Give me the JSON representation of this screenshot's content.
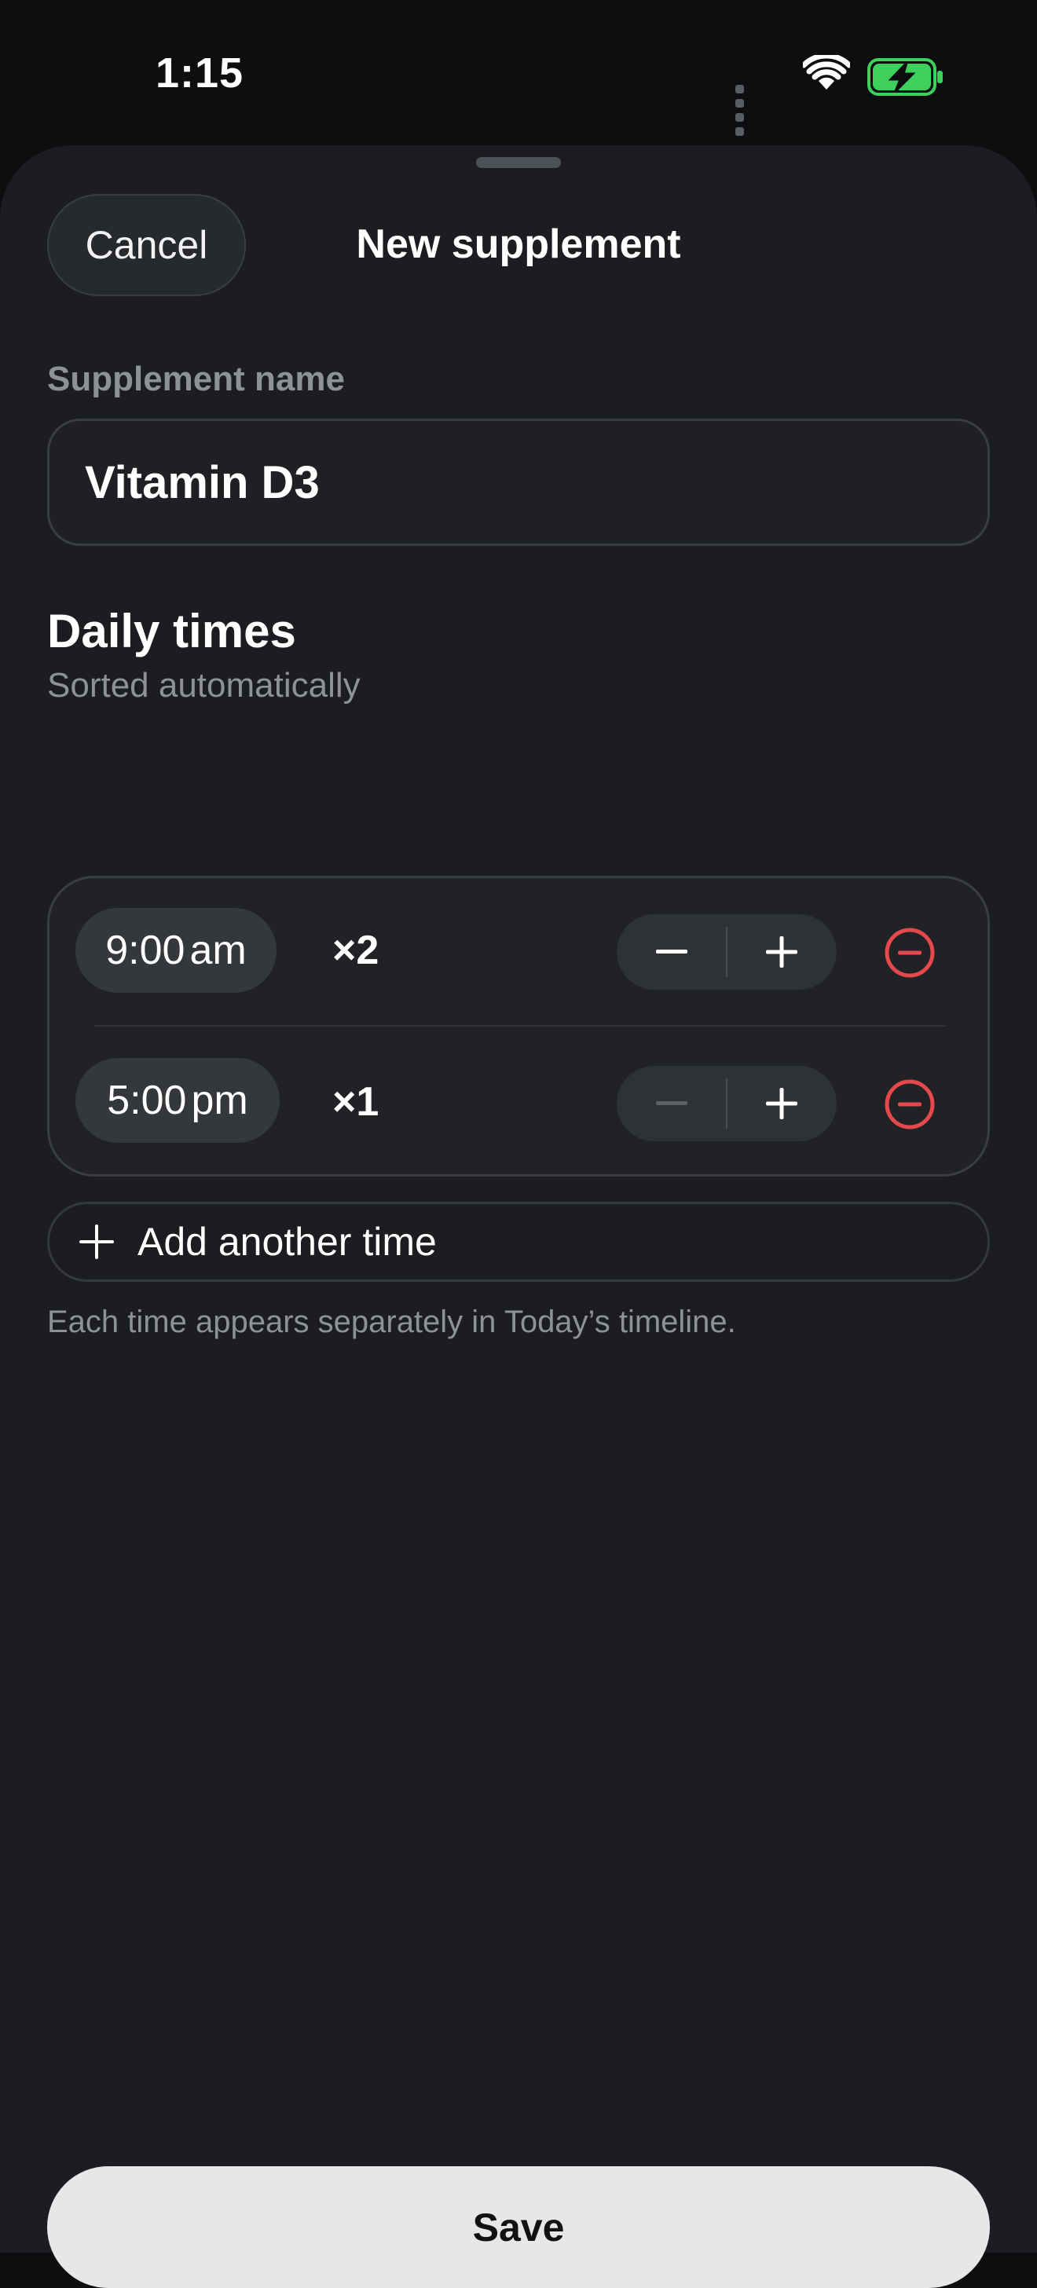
{
  "status_bar": {
    "time": "1:15",
    "battery_color": "#3dd15c"
  },
  "sheet": {
    "cancel_label": "Cancel",
    "title": "New supplement"
  },
  "form": {
    "name_label": "Supplement name",
    "name_value": "Vitamin D3"
  },
  "daily_times": {
    "title": "Daily times",
    "subtitle": "Sorted automatically",
    "rows": [
      {
        "time": "9:00",
        "ampm": "am",
        "count": "×2",
        "minus_enabled": true
      },
      {
        "time": "5:00",
        "ampm": "pm",
        "count": "×1",
        "minus_enabled": false
      }
    ],
    "add_label": "Add another time",
    "hint": "Each time appears separately in Today’s timeline."
  },
  "actions": {
    "save_label": "Save"
  },
  "colors": {
    "remove_red": "#e5484d",
    "sheet_bg": "#1b1d20"
  }
}
